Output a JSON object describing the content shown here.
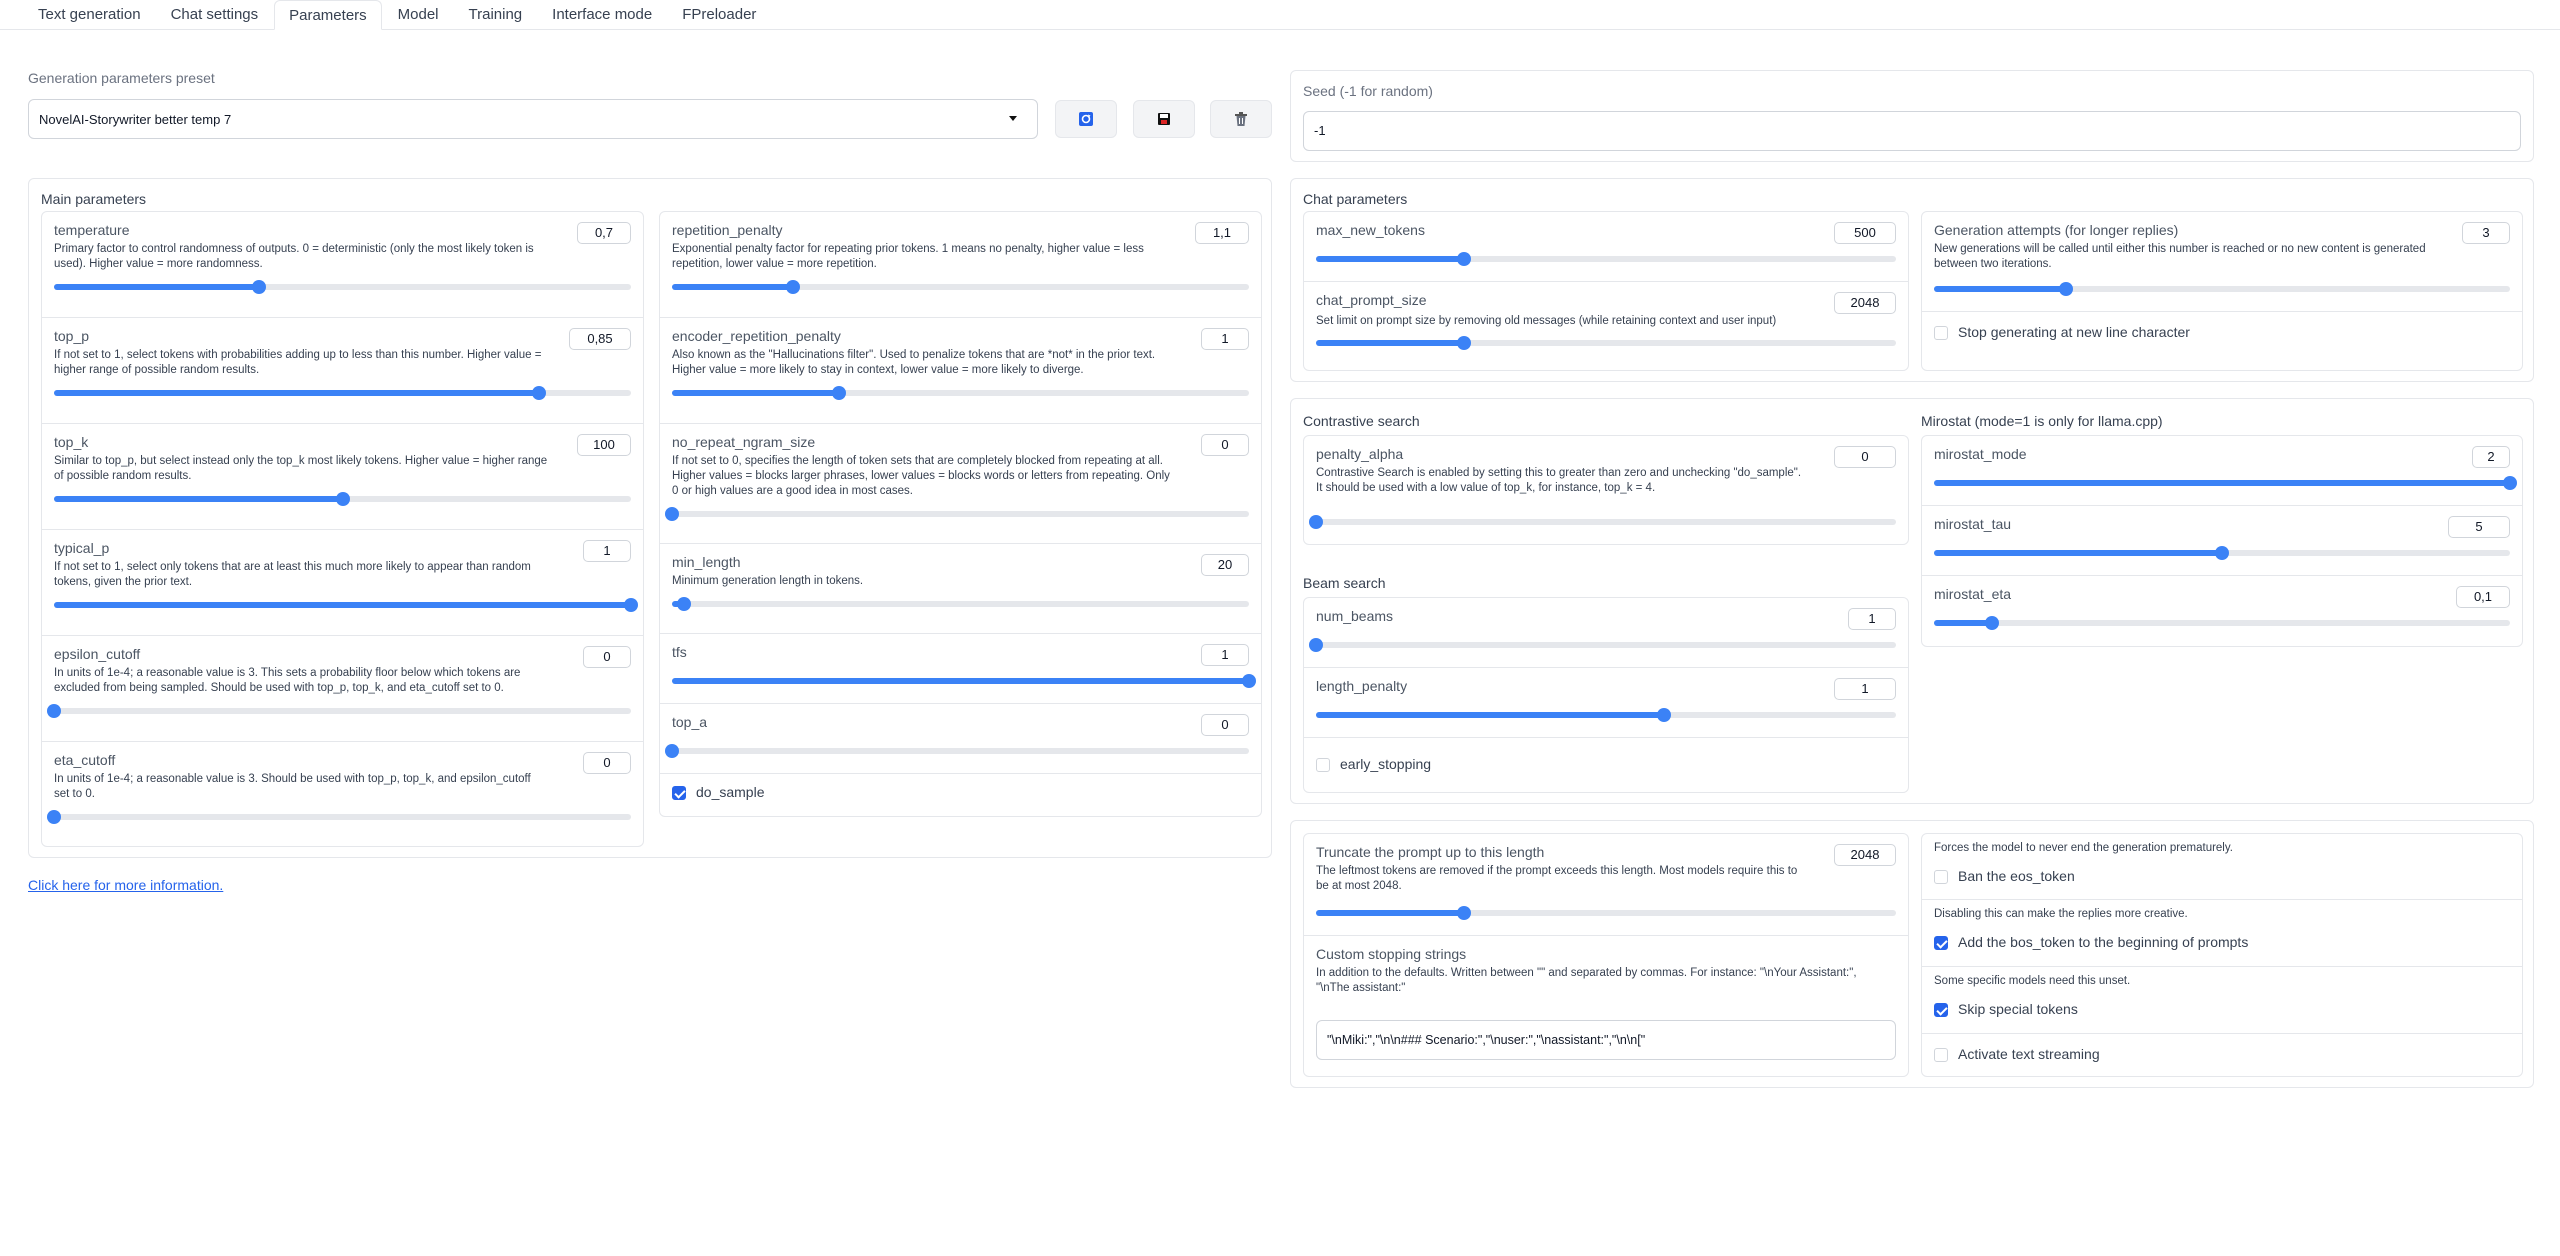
{
  "tabs": [
    "Text generation",
    "Chat settings",
    "Parameters",
    "Model",
    "Training",
    "Interface mode",
    "FPreloader"
  ],
  "active_tab": "Parameters",
  "preset": {
    "label": "Generation parameters preset",
    "value": "NovelAI-Storywriter better temp 7"
  },
  "seed": {
    "label": "Seed (-1 for random)",
    "value": "-1"
  },
  "main_params": {
    "title": "Main parameters",
    "left": [
      {
        "name": "temperature",
        "value": "0,7",
        "fill": 0.355,
        "desc": [
          "Primary factor to control randomness of outputs. 0 = deterministic (only the most likely token is",
          "used). Higher value = more randomness."
        ]
      },
      {
        "name": "top_p",
        "value": "0,85",
        "fill": 0.84,
        "desc": [
          "If not set to 1, select tokens with probabilities adding up to less than this number. Higher value =",
          "higher range of possible random results."
        ]
      },
      {
        "name": "top_k",
        "value": "100",
        "fill": 0.5,
        "desc": [
          "Similar to top_p, but select instead only the top_k most likely tokens. Higher value = higher range",
          "of possible random results."
        ]
      },
      {
        "name": "typical_p",
        "value": "1",
        "fill": 1.0,
        "desc": [
          "If not set to 1, select only tokens that are at least this much more likely to appear than random",
          "tokens, given the prior text."
        ]
      },
      {
        "name": "epsilon_cutoff",
        "value": "0",
        "fill": 0.0,
        "desc": [
          "In units of 1e-4; a reasonable value is 3. This sets a probability floor below which tokens are",
          "excluded from being sampled. Should be used with top_p, top_k, and eta_cutoff set to 0."
        ]
      },
      {
        "name": "eta_cutoff",
        "value": "0",
        "fill": 0.0,
        "desc": [
          "In units of 1e-4; a reasonable value is 3. Should be used with top_p, top_k, and epsilon_cutoff",
          "set to 0."
        ]
      }
    ],
    "right": [
      {
        "name": "repetition_penalty",
        "value": "1,1",
        "fill": 0.21,
        "desc": [
          "Exponential penalty factor for repeating prior tokens. 1 means no penalty, higher value = less",
          "repetition, lower value = more repetition."
        ]
      },
      {
        "name": "encoder_repetition_penalty",
        "value": "1",
        "fill": 0.29,
        "desc": [
          "Also known as the \"Hallucinations filter\". Used to penalize tokens that are *not* in the prior text.",
          "Higher value = more likely to stay in context, lower value = more likely to diverge."
        ]
      },
      {
        "name": "no_repeat_ngram_size",
        "value": "0",
        "fill": 0.0,
        "desc": [
          "If not set to 0, specifies the length of token sets that are completely blocked from repeating at all.",
          "Higher values = blocks larger phrases, lower values = blocks words or letters from repeating. Only",
          "0 or high values are a good idea in most cases."
        ]
      },
      {
        "name": "min_length",
        "value": "20",
        "fill": 0.02,
        "desc": [
          "Minimum generation length in tokens."
        ]
      },
      {
        "name": "tfs",
        "value": "1",
        "fill": 1.0,
        "desc": []
      },
      {
        "name": "top_a",
        "value": "0",
        "fill": 0.0,
        "desc": []
      }
    ],
    "do_sample": {
      "label": "do_sample",
      "checked": true
    }
  },
  "more_info_link": "Click here for more information.",
  "chat_params": {
    "title": "Chat parameters",
    "max_new_tokens": {
      "name": "max_new_tokens",
      "value": "500",
      "fill": 0.255
    },
    "chat_prompt_size": {
      "name": "chat_prompt_size",
      "value": "2048",
      "fill": 0.255,
      "desc": "Set limit on prompt size by removing old messages (while retaining context and user input)"
    },
    "generation_attempts": {
      "name": "Generation attempts (for longer replies)",
      "value": "3",
      "fill": 0.23,
      "desc": [
        "New generations will be called until either this number is reached or no new content is generated",
        "between two iterations."
      ]
    },
    "stop_newline": {
      "label": "Stop generating at new line character",
      "checked": false
    }
  },
  "contrastive": {
    "title": "Contrastive search",
    "penalty_alpha": {
      "name": "penalty_alpha",
      "value": "0",
      "fill": 0.0,
      "desc": [
        "Contrastive Search is enabled by setting this to greater than zero and unchecking \"do_sample\".",
        "It should be used with a low value of top_k, for instance, top_k = 4."
      ]
    }
  },
  "beam": {
    "title": "Beam search",
    "num_beams": {
      "name": "num_beams",
      "value": "1",
      "fill": 0.0
    },
    "length_penalty": {
      "name": "length_penalty",
      "value": "1",
      "fill": 0.6
    },
    "early_stopping": {
      "label": "early_stopping",
      "checked": false
    }
  },
  "mirostat": {
    "title": "Mirostat (mode=1 is only for llama.cpp)",
    "mode": {
      "name": "mirostat_mode",
      "value": "2",
      "fill": 1.0
    },
    "tau": {
      "name": "mirostat_tau",
      "value": "5",
      "fill": 0.5
    },
    "eta": {
      "name": "mirostat_eta",
      "value": "0,1",
      "fill": 0.1
    }
  },
  "truncate": {
    "name": "Truncate the prompt up to this length",
    "value": "2048",
    "fill": 0.255,
    "desc": [
      "The leftmost tokens are removed if the prompt exceeds this length. Most models require this to",
      "be at most 2048."
    ]
  },
  "stopping": {
    "name": "Custom stopping strings",
    "desc": [
      "In addition to the defaults. Written between \"\" and separated by commas. For instance: \"\\nYour Assistant:\",",
      "\"\\nThe assistant:\""
    ],
    "value": "\"\\nMiki:\",\"\\n\\n### Scenario:\",\"\\nuser:\",\"\\nassistant:\",\"\\n\\n[\""
  },
  "options": [
    {
      "info": "Forces the model to never end the generation prematurely.",
      "label": "Ban the eos_token",
      "checked": false
    },
    {
      "info": "Disabling this can make the replies more creative.",
      "label": "Add the bos_token to the beginning of prompts",
      "checked": true
    },
    {
      "info": "Some specific models need this unset.",
      "label": "Skip special tokens",
      "checked": true
    },
    {
      "info": "",
      "label": "Activate text streaming",
      "checked": false
    }
  ],
  "colors": {
    "accent": "#3b82f6",
    "border": "#e5e7eb",
    "link": "#2563eb"
  },
  "icons": {
    "refresh": "refresh-icon",
    "save": "save-icon",
    "delete": "trash-icon",
    "dropdown": "chevron-down-icon"
  }
}
